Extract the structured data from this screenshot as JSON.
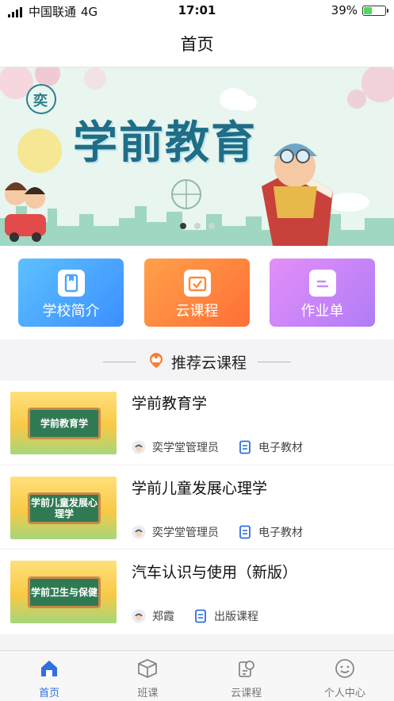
{
  "status_bar": {
    "carrier": "中国联通",
    "network": "4G",
    "time": "17:01",
    "battery": "39%",
    "battery_level": 0.39
  },
  "nav": {
    "title": "首页"
  },
  "banner": {
    "title": "学前教育",
    "logo_char": "奕",
    "slide_count": 3,
    "active_slide": 1
  },
  "quick_actions": [
    {
      "label": "学校简介",
      "icon": "bookmark-icon"
    },
    {
      "label": "云课程",
      "icon": "check-box-icon"
    },
    {
      "label": "作业单",
      "icon": "notes-icon"
    }
  ],
  "section": {
    "title": "推荐云课程",
    "icon": "crown-icon",
    "accent": "#ff7a2e"
  },
  "courses": [
    {
      "title": "学前教育学",
      "author": "奕学堂管理员",
      "type": "电子教材",
      "thumb_text": "学前教育学"
    },
    {
      "title": "学前儿童发展心理学",
      "author": "奕学堂管理员",
      "type": "电子教材",
      "thumb_text": "学前儿童发展心理学"
    },
    {
      "title": "汽车认识与使用（新版）",
      "author": "郑霞",
      "type": "出版课程",
      "thumb_text": "学前卫生与保健"
    }
  ],
  "tab_bar": {
    "items": [
      {
        "label": "首页",
        "icon": "home-icon",
        "active": true
      },
      {
        "label": "班课",
        "icon": "cube-icon",
        "active": false
      },
      {
        "label": "云课程",
        "icon": "cloud-course-icon",
        "active": false
      },
      {
        "label": "个人中心",
        "icon": "smiley-icon",
        "active": false
      }
    ],
    "active_color": "#2f6fe0"
  }
}
